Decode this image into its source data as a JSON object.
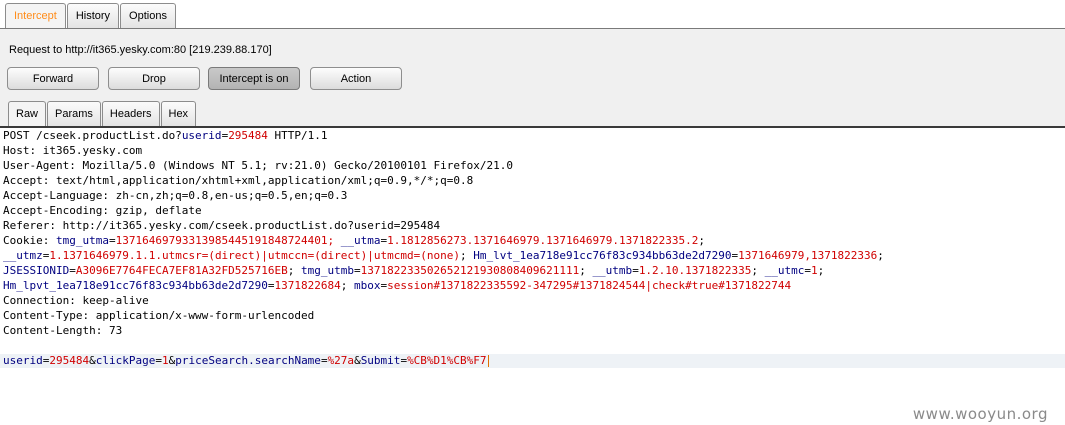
{
  "top_tabs": [
    "Intercept",
    "History",
    "Options"
  ],
  "request_line": "Request to http://it365.yesky.com:80  [219.239.88.170]",
  "buttons": {
    "forward": "Forward",
    "drop": "Drop",
    "intercept": "Intercept is on",
    "action": "Action"
  },
  "sub_tabs": [
    "Raw",
    "Params",
    "Headers",
    "Hex"
  ],
  "request": {
    "l1_method": "POST /cseek.productList.do?",
    "l1_pname": "userid",
    "l1_eq": "=",
    "l1_pval": "295484",
    "l1_proto": " HTTP/1.1",
    "host": "Host: it365.yesky.com",
    "user_agent": "User-Agent: Mozilla/5.0 (Windows NT 5.1; rv:21.0) Gecko/20100101 Firefox/21.0",
    "accept": "Accept: text/html,application/xhtml+xml,application/xml;q=0.9,*/*;q=0.8",
    "accept_language": "Accept-Language: zh-cn,zh;q=0.8,en-us;q=0.5,en;q=0.3",
    "accept_encoding": "Accept-Encoding: gzip, deflate",
    "referer": "Referer: http://it365.yesky.com/cseek.productList.do?userid=295484",
    "cookie1_label": "Cookie: ",
    "cookie1_n1": "tmg_utma",
    "cookie1_v1": "137164697933139854451918487244",
    "cookie1_sep1": "01; ",
    "cookie1_n2": "__utma",
    "cookie1_v2": "1.1812856273.1371646979.1371646979.1371822335.2",
    "cookie1_end": ";",
    "cookie2_n1": "__utmz",
    "cookie2_v1": "1.1371646979.1.1.utmcsr=(direct)|utmccn=(direct)|utmcmd=(none)",
    "cookie2_sep": "; ",
    "cookie2_n2": "Hm_lvt_1ea718e91cc76f83c934bb63de2d7290",
    "cookie2_v2": "1371646979,1371822336",
    "cookie2_end": ";",
    "cookie3_n1": "JSESSIONID",
    "cookie3_v1": "A3096E7764FECA7EF81A32FD525716EB",
    "cookie3_n2": "tmg_utmb",
    "cookie3_v2": "137182233502652121930808409621111",
    "cookie3_n3": "__utmb",
    "cookie3_v3": "1.2.10.1371822335",
    "cookie3_n4": "__utmc",
    "cookie3_v4": "1",
    "cookie4_n1": "Hm_lpvt_1ea718e91cc76f83c934bb63de2d7290",
    "cookie4_v1": "1371822684",
    "cookie4_n2": "mbox",
    "cookie4_v2": "session#1371822335592-347295#1371824544|check#true#1371822744",
    "connection": "Connection: keep-alive",
    "content_type": "Content-Type: application/x-www-form-urlencoded",
    "content_length": "Content-Length: 73",
    "body_n1": "userid",
    "body_v1": "295484",
    "body_n2": "clickPage",
    "body_v2": "1",
    "body_n3": "priceSearch.searchName",
    "body_v3": "%27a",
    "body_n4": "Submit",
    "body_v4": "%CB%D1%CB%F7"
  },
  "watermark": "www.wooyun.org"
}
